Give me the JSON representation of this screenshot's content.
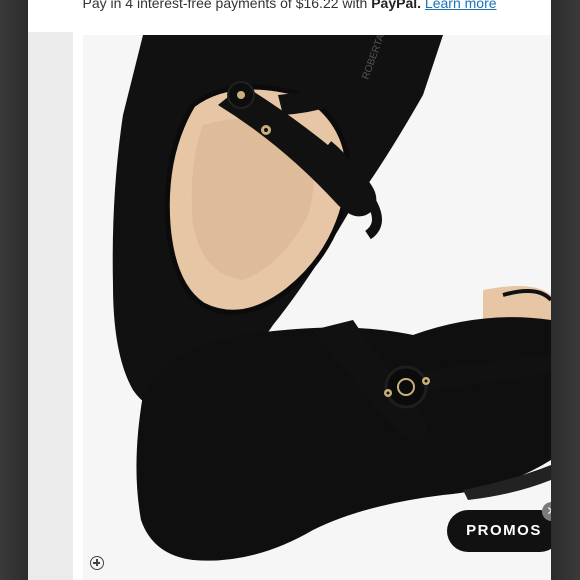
{
  "payment": {
    "text_prefix": "Pay in 4 interest-free payments of $16.22 with ",
    "provider": "PayPal.",
    "link": "Learn more"
  },
  "product_image": {
    "subject": "black suede mary jane flats with buckle strap",
    "brand_imprint": "ROBERTA",
    "colors": {
      "suede": "#0e0e0e",
      "lining": "#e8c9a9",
      "hardware": "#c9b07a",
      "background": "#f6f6f6"
    }
  },
  "zoom": {
    "icon": "zoom-in-icon"
  },
  "promos": {
    "label": "PROMOS",
    "close_icon": "close-icon",
    "close_glyph": "✕"
  }
}
